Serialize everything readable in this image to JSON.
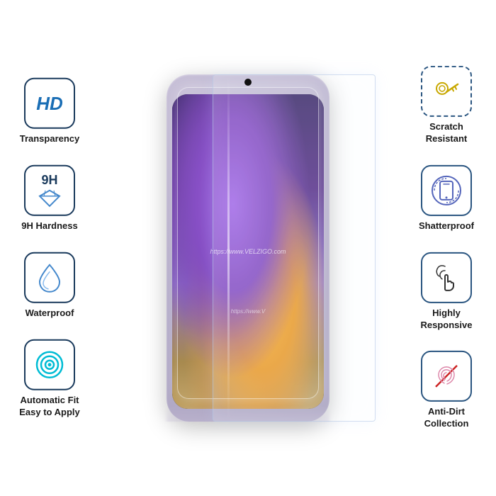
{
  "features": {
    "left": [
      {
        "id": "hd-transparency",
        "icon_type": "hd",
        "label": "Transparency"
      },
      {
        "id": "9h-hardness",
        "icon_type": "9h",
        "label": "9H Hardness"
      },
      {
        "id": "waterproof",
        "icon_type": "drop",
        "label": "Waterproof"
      },
      {
        "id": "automatic-fit",
        "icon_type": "target",
        "label": "Automatic Fit\nEasy to Apply"
      }
    ],
    "right": [
      {
        "id": "scratch-resistant",
        "icon_type": "key",
        "label": "Scratch\nResistant"
      },
      {
        "id": "shatterproof",
        "icon_type": "phone-circle",
        "label": "Shatterproof"
      },
      {
        "id": "highly-responsive",
        "icon_type": "touch",
        "label": "Highly\nResponsive"
      },
      {
        "id": "anti-dirt",
        "icon_type": "fingerprint",
        "label": "Anti-Dirt\nCollection"
      }
    ]
  },
  "watermark": "https://www.VELZIGO.com",
  "watermark2": "https://www.V",
  "brand": "VELZIGO"
}
